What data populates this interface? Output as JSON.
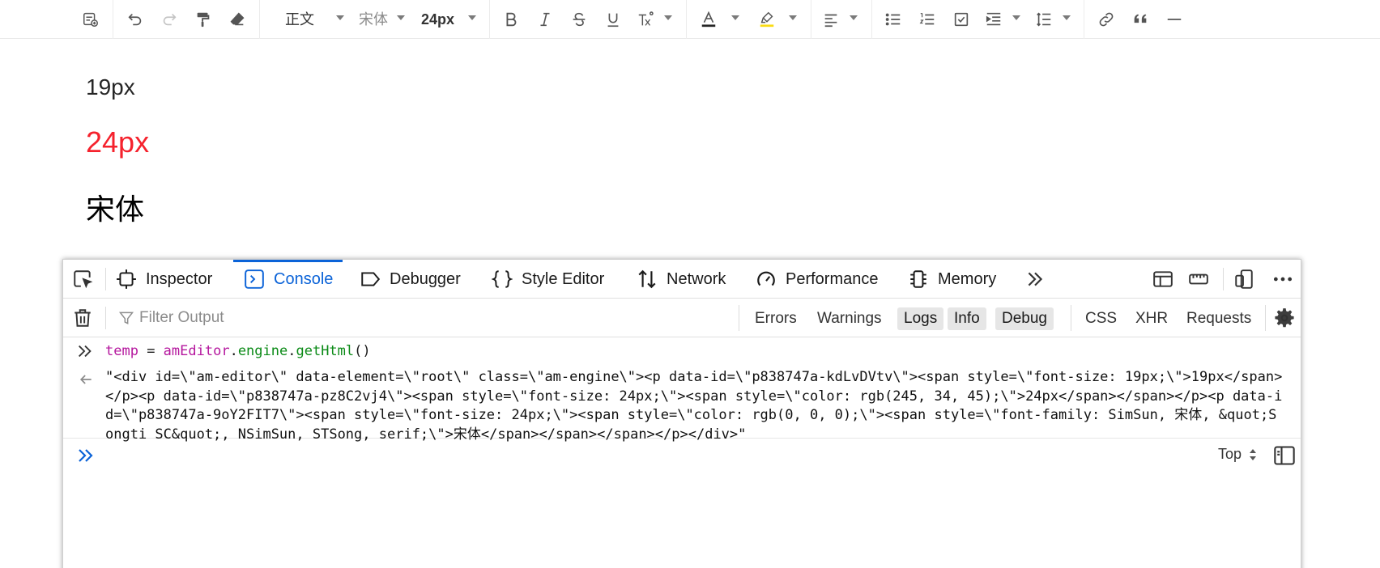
{
  "toolbar": {
    "heading_select": "正文",
    "font_family_select": "宋体",
    "font_size_select": "24px",
    "colors": {
      "font_color_bar": "#262626",
      "highlight_bar": "#fadb14"
    }
  },
  "document": {
    "lines": [
      "19px",
      "24px",
      "宋体"
    ],
    "colors": {
      "line2": "rgb(245, 34, 45)"
    }
  },
  "devtools": {
    "tabs": {
      "inspector": "Inspector",
      "console": "Console",
      "debugger": "Debugger",
      "style_editor": "Style Editor",
      "network": "Network",
      "performance": "Performance",
      "memory": "Memory"
    },
    "filter": {
      "placeholder": "Filter Output",
      "levels": [
        "Errors",
        "Warnings",
        "Logs",
        "Info",
        "Debug"
      ],
      "active_levels": [
        "Logs",
        "Info",
        "Debug"
      ],
      "types": [
        "CSS",
        "XHR",
        "Requests"
      ]
    },
    "console": {
      "input": {
        "var": "temp",
        "eq": " = ",
        "obj": "amEditor",
        "dot1": ".",
        "prop1": "engine",
        "dot2": ".",
        "prop2": "getHtml",
        "call": "()"
      },
      "output": "\"<div id=\\\"am-editor\\\" data-element=\\\"root\\\" class=\\\"am-engine\\\"><p data-id=\\\"p838747a-kdLvDVtv\\\"><span style=\\\"font-size: 19px;\\\">19px</span></p><p data-id=\\\"p838747a-pz8C2vj4\\\"><span style=\\\"font-size: 24px;\\\"><span style=\\\"color: rgb(245, 34, 45);\\\">24px</span></span></p><p data-id=\\\"p838747a-9oY2FIT7\\\"><span style=\\\"font-size: 24px;\\\"><span style=\\\"color: rgb(0, 0, 0);\\\"><span style=\\\"font-family: SimSun, 宋体, &quot;Songti SC&quot;, NSimSun, STSong, serif;\\\">宋体</span></span></span></p></div>\"",
      "context_select": "Top"
    },
    "colors": {
      "accent": "#0b63d8"
    }
  }
}
